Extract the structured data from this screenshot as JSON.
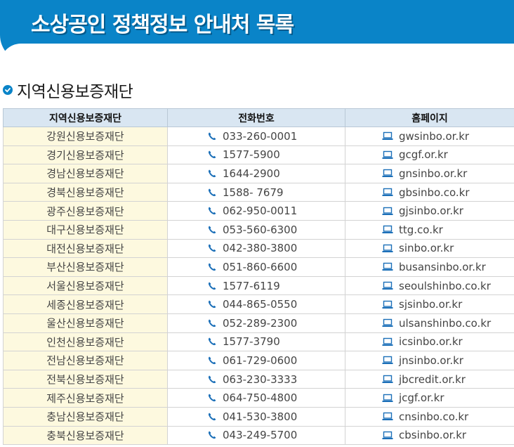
{
  "banner": {
    "title": "소상공인 정책정보 안내처 목록"
  },
  "section": {
    "title": "지역신용보증재단"
  },
  "table": {
    "headers": [
      "지역신용보증재단",
      "전화번호",
      "홈페이지"
    ],
    "rows": [
      {
        "region": "강원신용보증재단",
        "phone": "033-260-0001",
        "site": "gwsinbo.or.kr"
      },
      {
        "region": "경기신용보증재단",
        "phone": "1577-5900",
        "site": "gcgf.or.kr"
      },
      {
        "region": "경남신용보증재단",
        "phone": "1644-2900",
        "site": "gnsinbo.or.kr"
      },
      {
        "region": "경북신용보증재단",
        "phone": "1588- 7679",
        "site": "gbsinbo.co.kr"
      },
      {
        "region": "광주신용보증재단",
        "phone": "062-950-0011",
        "site": "gjsinbo.or.kr"
      },
      {
        "region": "대구신용보증재단",
        "phone": "053-560-6300",
        "site": "ttg.co.kr"
      },
      {
        "region": "대전신용보증재단",
        "phone": "042-380-3800",
        "site": "sinbo.or.kr"
      },
      {
        "region": "부산신용보증재단",
        "phone": "051-860-6600",
        "site": "busansinbo.or.kr"
      },
      {
        "region": "서울신용보증재단",
        "phone": "1577-6119",
        "site": "seoulshinbo.co.kr"
      },
      {
        "region": "세종신용보증재단",
        "phone": "044-865-0550",
        "site": "sjsinbo.or.kr"
      },
      {
        "region": "울산신용보증재단",
        "phone": "052-289-2300",
        "site": "ulsanshinbo.co.kr"
      },
      {
        "region": "인천신용보증재단",
        "phone": "1577-3790",
        "site": "icsinbo.or.kr"
      },
      {
        "region": "전남신용보증재단",
        "phone": "061-729-0600",
        "site": "jnsinbo.or.kr"
      },
      {
        "region": "전북신용보증재단",
        "phone": "063-230-3333",
        "site": "jbcredit.or.kr"
      },
      {
        "region": "제주신용보증재단",
        "phone": "064-750-4800",
        "site": "jcgf.or.kr"
      },
      {
        "region": "충남신용보증재단",
        "phone": "041-530-3800",
        "site": "cnsinbo.co.kr"
      },
      {
        "region": "충북신용보증재단",
        "phone": "043-249-5700",
        "site": "cbsinbo.or.kr"
      }
    ]
  },
  "icons": {
    "phone": "phone-icon",
    "site": "laptop-icon",
    "heading": "check-circle-icon"
  },
  "colors": {
    "banner": "#0a84c8",
    "header_bg": "#d9e6f2",
    "region_bg": "#fdf9df",
    "icon": "#1b6fb8"
  }
}
